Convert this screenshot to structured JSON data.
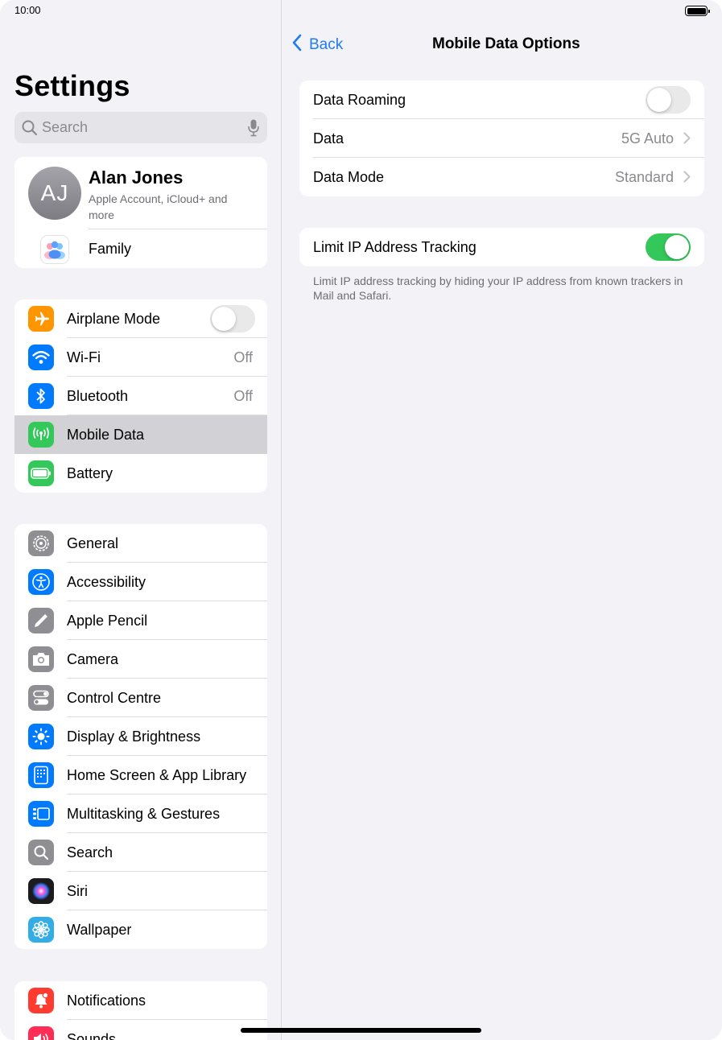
{
  "status_bar": {
    "time": "10:00"
  },
  "sidebar": {
    "title": "Settings",
    "search_placeholder": "Search",
    "account": {
      "initials": "AJ",
      "name": "Alan Jones",
      "subtitle": "Apple Account, iCloud+ and more",
      "family_label": "Family"
    },
    "connectivity": [
      {
        "label": "Airplane Mode",
        "icon": "airplane-icon",
        "color": "#ff9500",
        "toggle": false
      },
      {
        "label": "Wi-Fi",
        "icon": "wifi-icon",
        "color": "#007aff",
        "value": "Off"
      },
      {
        "label": "Bluetooth",
        "icon": "bluetooth-icon",
        "color": "#007aff",
        "value": "Off"
      },
      {
        "label": "Mobile Data",
        "icon": "antenna-icon",
        "color": "#34c759",
        "selected": true
      },
      {
        "label": "Battery",
        "icon": "battery-icon",
        "color": "#34c759"
      }
    ],
    "general": [
      {
        "label": "General",
        "icon": "gear-icon",
        "color": "#8e8e93"
      },
      {
        "label": "Accessibility",
        "icon": "accessibility-icon",
        "color": "#007aff"
      },
      {
        "label": "Apple Pencil",
        "icon": "pencil-icon",
        "color": "#8e8e93"
      },
      {
        "label": "Camera",
        "icon": "camera-icon",
        "color": "#8e8e93"
      },
      {
        "label": "Control Centre",
        "icon": "switches-icon",
        "color": "#8e8e93"
      },
      {
        "label": "Display & Brightness",
        "icon": "sun-icon",
        "color": "#007aff"
      },
      {
        "label": "Home Screen & App Library",
        "icon": "home-screen-icon",
        "color": "#007aff"
      },
      {
        "label": "Multitasking & Gestures",
        "icon": "multitasking-icon",
        "color": "#007aff"
      },
      {
        "label": "Search",
        "icon": "search-icon",
        "color": "#8e8e93"
      },
      {
        "label": "Siri",
        "icon": "siri-icon",
        "color": "#1c1c1e"
      },
      {
        "label": "Wallpaper",
        "icon": "flower-icon",
        "color": "#32ade6"
      }
    ],
    "notifications": [
      {
        "label": "Notifications",
        "icon": "bell-icon",
        "color": "#ff3b30"
      },
      {
        "label": "Sounds",
        "icon": "speaker-icon",
        "color": "#ff2d55"
      }
    ]
  },
  "detail": {
    "back_label": "Back",
    "title": "Mobile Data Options",
    "group1": [
      {
        "label": "Data Roaming",
        "toggle": false
      },
      {
        "label": "Data",
        "value": "5G Auto"
      },
      {
        "label": "Data Mode",
        "value": "Standard"
      }
    ],
    "group2": [
      {
        "label": "Limit IP Address Tracking",
        "toggle": true
      }
    ],
    "footnote": "Limit IP address tracking by hiding your IP address from known trackers in Mail and Safari."
  }
}
